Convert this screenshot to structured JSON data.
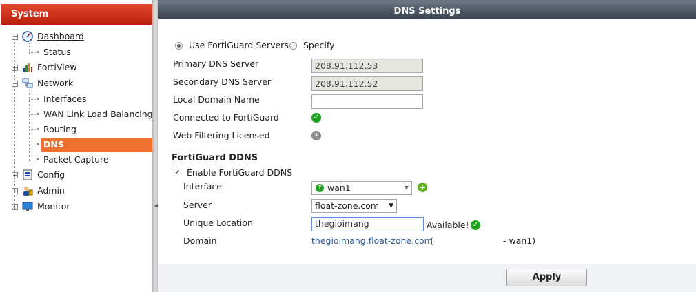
{
  "sidebar": {
    "title": "System",
    "items": [
      {
        "label": "Dashboard"
      },
      {
        "label": "Status"
      },
      {
        "label": "FortiView"
      },
      {
        "label": "Network"
      },
      {
        "label": "Interfaces"
      },
      {
        "label": "WAN Link Load Balancing"
      },
      {
        "label": "Routing"
      },
      {
        "label": "DNS"
      },
      {
        "label": "Packet Capture"
      },
      {
        "label": "Config"
      },
      {
        "label": "Admin"
      },
      {
        "label": "Monitor"
      }
    ]
  },
  "page": {
    "title": "DNS Settings"
  },
  "dns": {
    "use_fortiguard_label": "Use FortiGuard Servers",
    "specify_label": "Specify",
    "primary_label": "Primary DNS Server",
    "primary_value": "208.91.112.53",
    "secondary_label": "Secondary DNS Server",
    "secondary_value": "208.91.112.52",
    "local_domain_label": "Local Domain Name",
    "local_domain_value": "",
    "connected_label": "Connected to FortiGuard",
    "web_filtering_label": "Web Filtering Licensed"
  },
  "ddns": {
    "heading": "FortiGuard DDNS",
    "enable_label": "Enable FortiGuard DDNS",
    "interface_label": "Interface",
    "interface_value": "wan1",
    "server_label": "Server",
    "server_value": "float-zone.com",
    "unique_location_label": "Unique Location",
    "unique_location_value": "thegioimang",
    "available_label": "Available!",
    "domain_label": "Domain",
    "domain_value": "thegioimang.float-zone.com",
    "domain_open": "(",
    "domain_suffix": "- wan1)"
  },
  "footer": {
    "apply_label": "Apply"
  },
  "colors": {
    "sidebar_header": "#c9301a",
    "active_item": "#f07030",
    "main_header": "#4a5561",
    "ok_green": "#1fa31f",
    "link": "#2c5aa0"
  },
  "icons": {
    "dashboard": "dashboard-gauge-icon",
    "fortiview": "bar-chart-icon",
    "network": "network-icon",
    "config": "config-icon",
    "admin": "admin-users-icon",
    "monitor": "monitor-icon",
    "connected": "check-circle-icon",
    "web_filtering": "x-circle-icon",
    "interface": "interface-up-icon",
    "add": "add-icon",
    "available": "check-circle-icon"
  }
}
